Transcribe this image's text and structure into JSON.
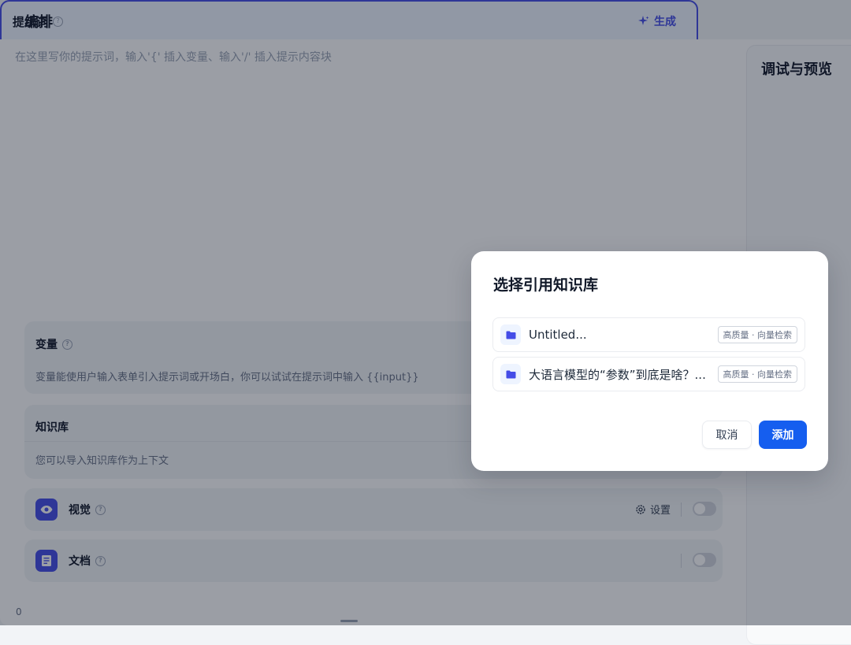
{
  "page": {
    "title": "编排"
  },
  "prompt": {
    "title": "提示词",
    "help": "?",
    "generate_label": "生成",
    "placeholder": "在这里写你的提示词，输入'{' 插入变量、输入'/' 插入提示内容块",
    "char_count": "0"
  },
  "variables": {
    "title": "变量",
    "help": "?",
    "description": "变量能使用户输入表单引入提示词或开场白，你可以试试在提示词中输入 {{input}}"
  },
  "knowledge": {
    "title": "知识库",
    "description": "您可以导入知识库作为上下文"
  },
  "features": {
    "vision": {
      "label": "视觉",
      "help": "?",
      "settings_label": "设置",
      "enabled": false,
      "icon": "eye-icon"
    },
    "document": {
      "label": "文档",
      "help": "?",
      "enabled": false,
      "icon": "document-icon"
    }
  },
  "preview": {
    "title": "调试与预览"
  },
  "modal": {
    "title": "选择引用知识库",
    "items": [
      {
        "name": "Untitled...",
        "badge": "高质量 · 向量检索",
        "icon": "folder-icon"
      },
      {
        "name": "大语言模型的“参数”到底是啥？....",
        "badge": "高质量 · 向量检索",
        "icon": "folder-icon"
      }
    ],
    "cancel_label": "取消",
    "add_label": "添加"
  },
  "colors": {
    "accent": "#444ce7",
    "primary_button": "#155eef",
    "overlay": "rgba(16,24,40,0.42)"
  }
}
